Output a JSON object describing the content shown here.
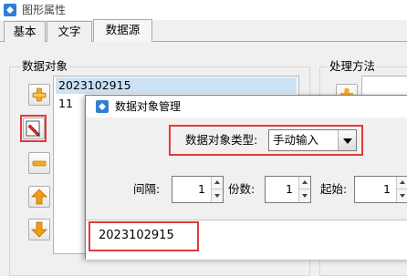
{
  "window": {
    "title": "图形属性"
  },
  "tabs": [
    {
      "label": "基本"
    },
    {
      "label": "文字"
    },
    {
      "label": "数据源"
    }
  ],
  "data_objects": {
    "heading": "数据对象",
    "items": [
      "2023102915",
      "11"
    ]
  },
  "processing": {
    "heading": "处理方法"
  },
  "dialog": {
    "title": "数据对象管理",
    "type_label": "数据对象类型:",
    "type_value": "手动输入",
    "interval_label": "间隔:",
    "interval_value": "1",
    "copies_label": "份数:",
    "copies_value": "1",
    "start_label": "起始:",
    "start_value": "1",
    "content_value": "2023102915"
  },
  "colors": {
    "highlight_red": "#e23a3a",
    "selection_blue": "#cce1f5",
    "plus_orange": "#f5a623",
    "arrow_orange": "#f39c12"
  }
}
